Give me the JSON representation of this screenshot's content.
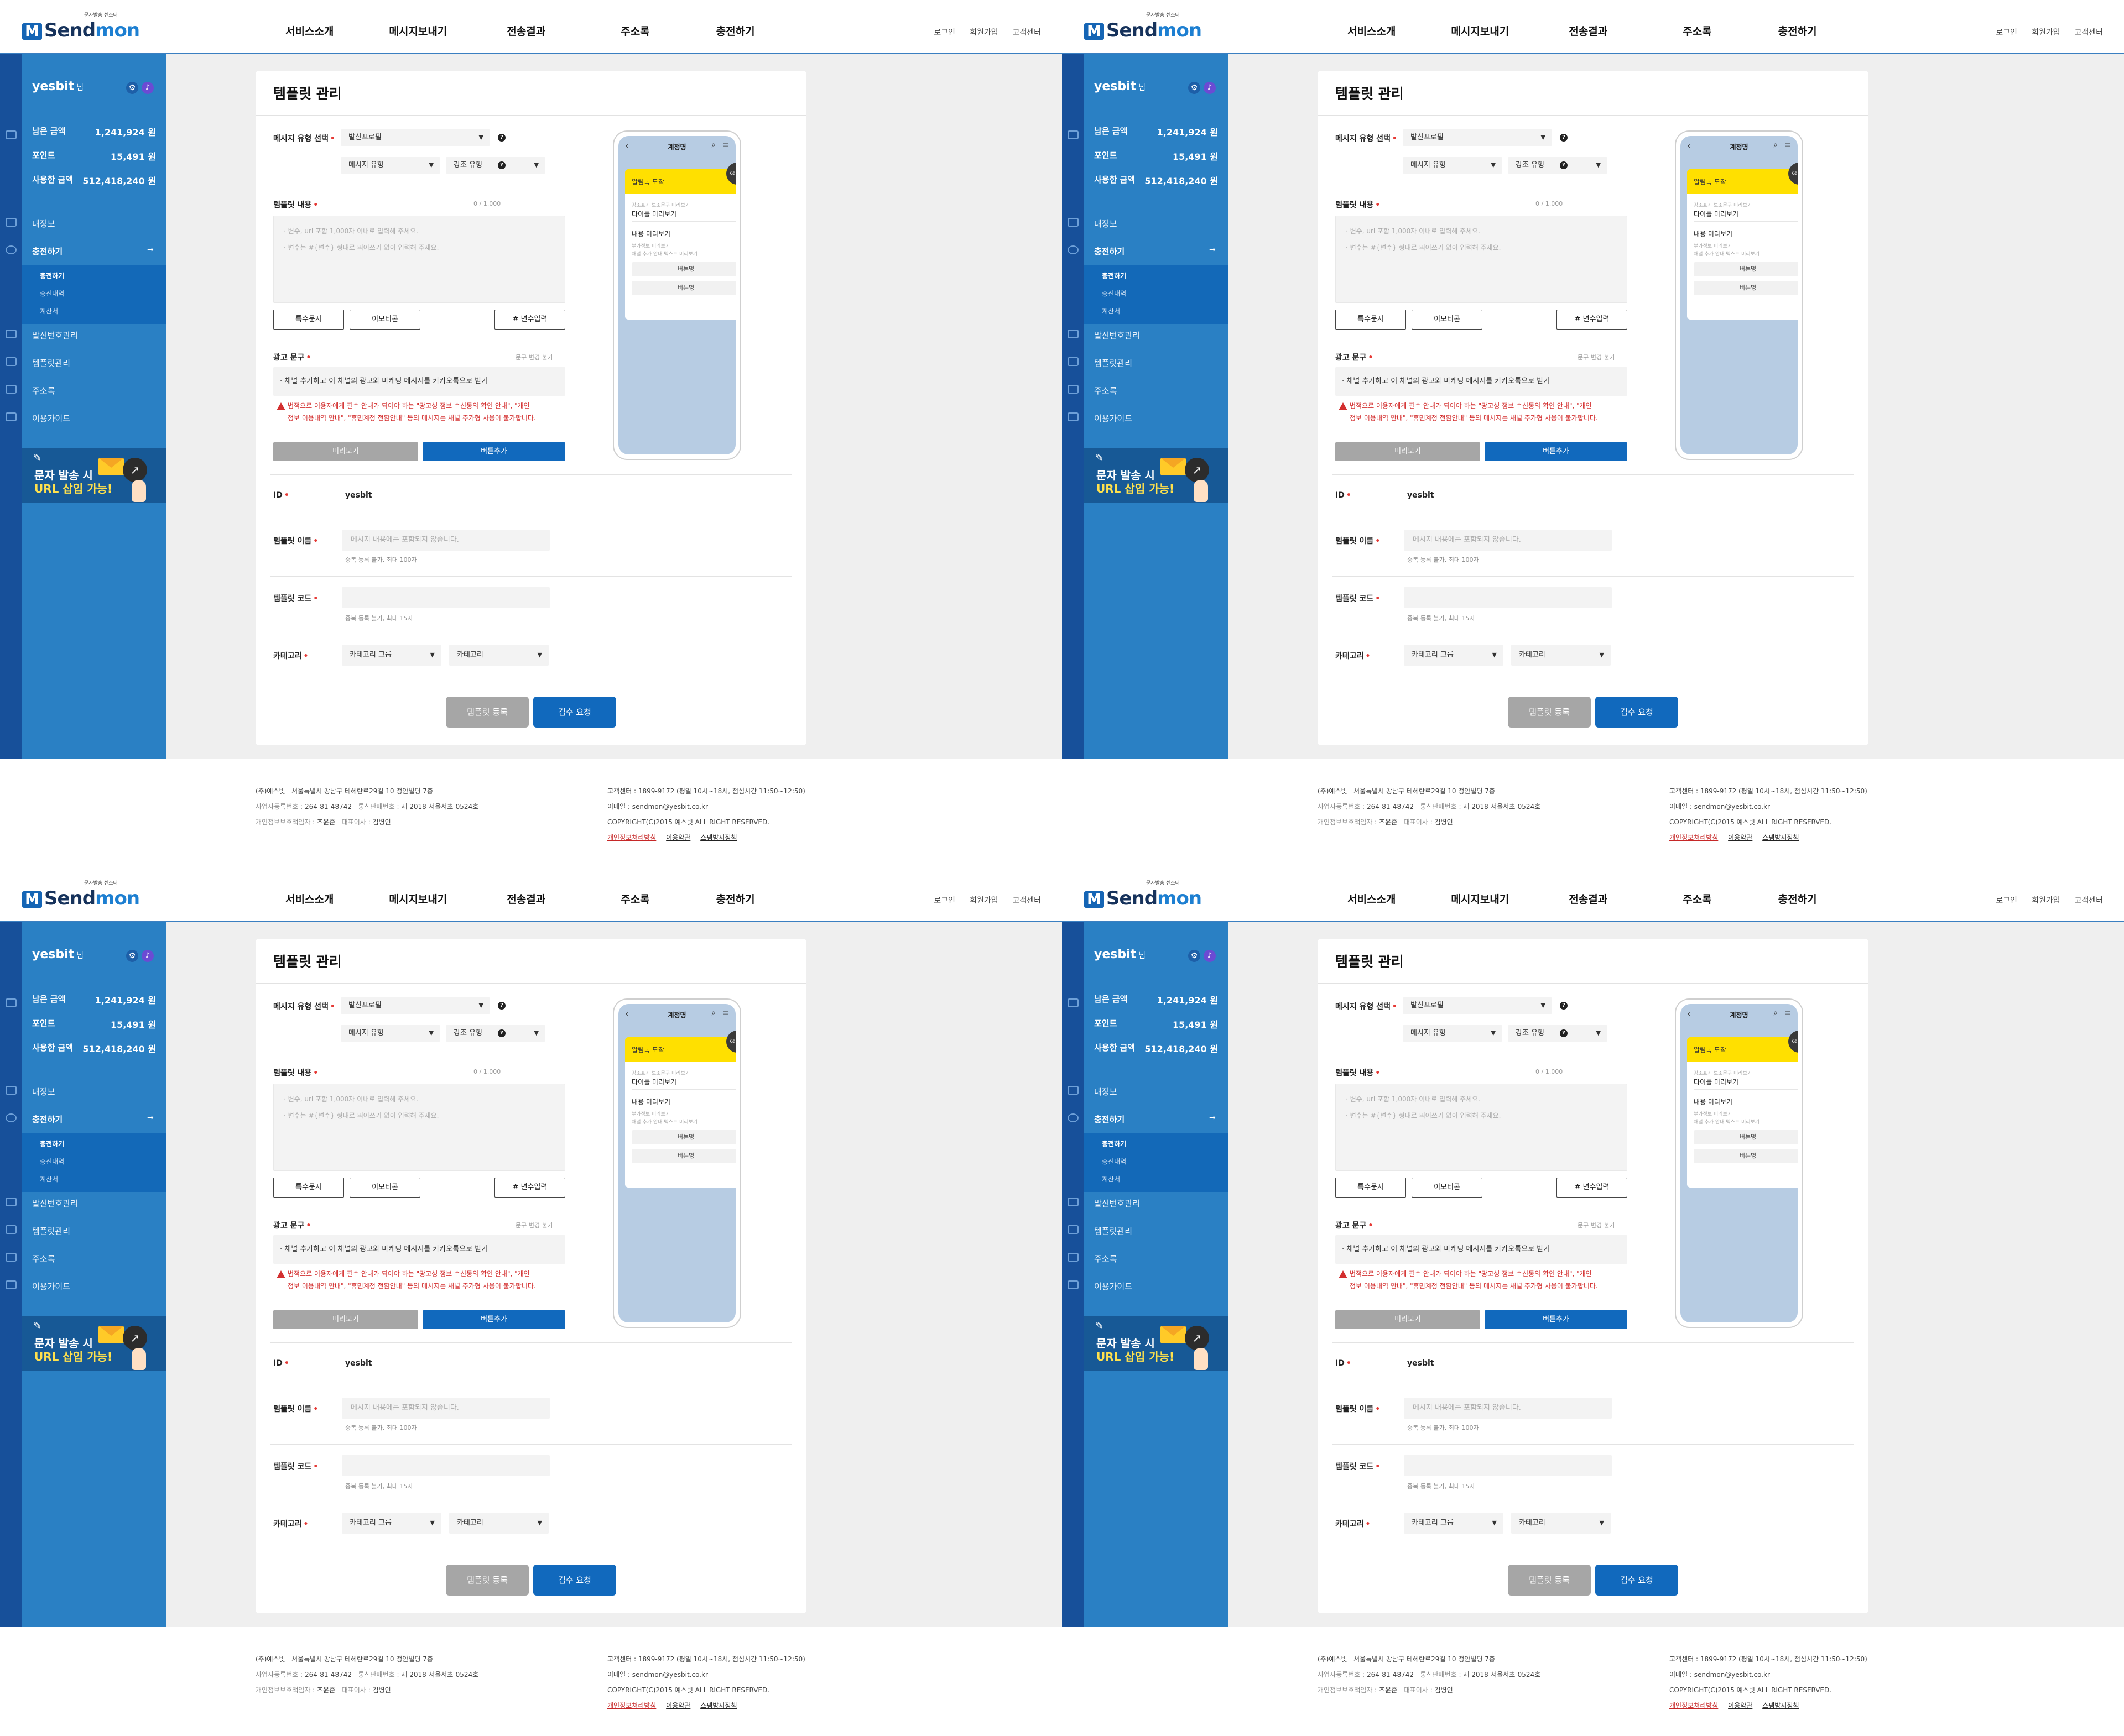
{
  "header": {
    "logo_mark": "M",
    "logo_send": "Send",
    "logo_mon": "mon",
    "logo_tag": "문자발송 센스터",
    "nav": [
      "서비스소개",
      "메시지보내기",
      "전송결과",
      "주소록",
      "충전하기"
    ],
    "util": [
      "로그인",
      "회원가입",
      "고객센터"
    ]
  },
  "sidebar": {
    "user_name": "yesbit",
    "user_suffix": "님",
    "stats": [
      {
        "label": "남은 금액",
        "value": "1,241,924 원"
      },
      {
        "label": "포인트",
        "value": "15,491 원"
      },
      {
        "label": "사용한 금액",
        "value": "512,418,240 원"
      }
    ],
    "menu_info": "내정보",
    "menu_charge": "충전하기",
    "submenu": [
      "충전하기",
      "충전내역",
      "계산서"
    ],
    "menu_after": [
      "발신번호관리",
      "템플릿관리",
      "주소록",
      "이용가이드"
    ],
    "banner_line1": "문자 발송 시",
    "banner_line2": "URL 삽입 가능!"
  },
  "main": {
    "title": "템플릿 관리",
    "msg_type_label": "메시지 유형 선택",
    "msg_type_value": "발신프로필",
    "msg_subtype": "메시지 유형",
    "emphasis_type": "강조 유형",
    "content_label": "템플릿 내용",
    "content_counter": "0 / 1,000",
    "content_ph1": "· 변수, url 포함 1,000자 이내로 입력해 주세요.",
    "content_ph2": "· 변수는 #{변수} 형태로 띄어쓰기 없이 입력해 주세요.",
    "btn_special": "특수문자",
    "btn_emoticon": "이모티콘",
    "btn_variable": "# 변수입력",
    "ad_label": "광고 문구",
    "ad_note": "문구 변경 불가",
    "ad_text": "· 채널 추가하고 이 채널의 광고와 마케팅 메시지를 카카오톡으로 받기",
    "warn_line1": "법적으로 이용자에게 필수 안내가 되어야 하는 \"광고성 정보 수신동의 확인 안내\", \"개인",
    "warn_line2": "정보 이용내역 안내\", \"휴면계정 전환안내\" 등의 메시지는 채널 추가형 사용이 불가합니다.",
    "btn_preview": "미리보기",
    "btn_add_button": "버튼추가",
    "id_label": "ID",
    "id_value": "yesbit",
    "tpl_name_label": "템플릿 이름",
    "tpl_name_ph": "메시지 내용에는 포함되지 않습니다.",
    "tpl_name_hint": "중복 등록 불가, 최대 100자",
    "tpl_code_label": "템플릿 코드",
    "tpl_code_hint": "중복 등록 불가, 최대 15자",
    "category_label": "카테고리",
    "category_group": "카테고리 그룹",
    "category": "카테고리",
    "btn_register": "템플릿 등록",
    "btn_review": "검수 요청"
  },
  "phone": {
    "title": "계정명",
    "badge": "kakao",
    "head": "알림톡 도착",
    "sub1": "강조표기 보조문구 미리보기",
    "title_preview": "타이틀 미리보기",
    "content_preview": "내용 미리보기",
    "extra1": "부가정보 미리보기",
    "extra2": "채널 추가 안내 텍스트 미리보기",
    "btn1": "버튼명",
    "btn2": "버튼명"
  },
  "footer": {
    "company": "(주)예스빗",
    "address": "서울특별시 강남구 테헤란로29길 10 정안빌딩 7층",
    "biz_key": "사업자등록번호 :",
    "biz_val": "264-81-48742",
    "mail_key": "통신판매번호 :",
    "mail_val": "제 2018-서울서초-0524호",
    "privacy_key": "개인정보보호책임자 :",
    "privacy_val": "조윤준",
    "ceo_key": "대표이사 :",
    "ceo_val": "김병인",
    "cs": "고객센터 : 1899-9172 (평일 10시~18시, 점심시간 11:50~12:50)",
    "email": "이메일 : sendmon@yesbit.co.kr",
    "copyright": "COPYRIGHT(C)2015 예스빗 ALL RIGHT RESERVED.",
    "link_privacy": "개인정보처리방침",
    "link_terms": "이용약관",
    "link_spam": "스팸방지정책"
  },
  "colors": {
    "brand_blue": "#1169bd",
    "sidebar_blue": "#2a80c4",
    "warning_red": "#d32f2f",
    "kakao_yellow": "#ffe000"
  }
}
